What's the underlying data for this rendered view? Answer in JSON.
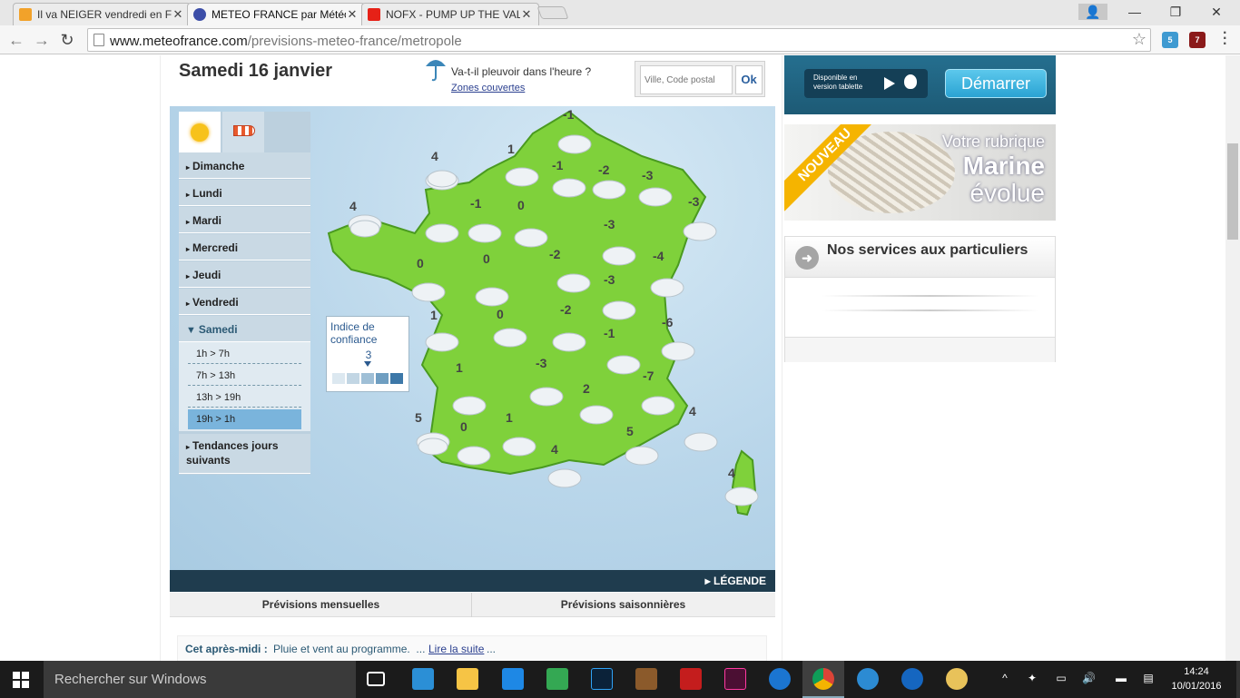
{
  "browser": {
    "tabs": [
      {
        "title": "Il va NEIGER vendredi en F",
        "favicon_color": "#f2a22a"
      },
      {
        "title": "METEO FRANCE par Météo",
        "favicon_color": "#3c4ea8"
      },
      {
        "title": "NOFX - PUMP UP THE VAL",
        "favicon_color": "#e62117"
      }
    ],
    "url_domain": "www.meteofrance.com",
    "url_path": "/previsions-meteo-france/metropole",
    "extensions": [
      {
        "icon": "ghostery-icon",
        "badge": "5",
        "color": "#3f9ad1"
      },
      {
        "icon": "ublock-icon",
        "badge": "7",
        "color": "#8b1a1a"
      }
    ]
  },
  "page": {
    "day_title": "Samedi 16 janvier",
    "rain_question": "Va-t-il pleuvoir dans l'heure ?",
    "zones_link": "Zones couvertes",
    "search_placeholder": "Ville, Code postal",
    "ok_label": "Ok",
    "days": [
      "Dimanche",
      "Lundi",
      "Mardi",
      "Mercredi",
      "Jeudi",
      "Vendredi",
      "Samedi"
    ],
    "open_day_index": 6,
    "time_slots": [
      "1h > 7h",
      "7h > 13h",
      "13h > 19h",
      "19h > 1h"
    ],
    "selected_slot_index": 3,
    "tendances": "Tendances jours suivants",
    "confidence_label": "Indice de confiance",
    "confidence_value": "3",
    "confidence_scale": [
      "#dce8f0",
      "#c2d6e4",
      "#9fbfd6",
      "#6f9ec1",
      "#3d78a8"
    ],
    "legend_link": "LÉGENDE",
    "prev_monthly": "Prévisions mensuelles",
    "prev_seasonal": "Prévisions saisonnières",
    "summary_label": "Cet après-midi :",
    "summary_text": "Pluie et vent au programme.",
    "summary_link": "Lire la suite",
    "summary_dots": "...",
    "summary_pre_dots": "...",
    "map_temperatures": [
      "-1",
      "1",
      "4",
      "-1",
      "-2",
      "-3",
      "-3",
      "4",
      "-1",
      "0",
      "-3",
      "0",
      "-2",
      "-4",
      "0",
      "-3",
      "-6",
      "1",
      "0",
      "-2",
      "-1",
      "1",
      "-3",
      "-7",
      "2",
      "4",
      "5",
      "0",
      "1",
      "5",
      "4",
      "4"
    ]
  },
  "sidebar_ads": {
    "app_store_text": "Disponible en version tablette",
    "app_button": "Démarrer",
    "marine_ribbon": "NOUVEAU",
    "marine_line1": "Votre rubrique",
    "marine_line2": "Marine",
    "marine_line3": "évolue",
    "services_title": "Nos services aux particuliers"
  },
  "taskbar": {
    "search_placeholder": "Rechercher sur Windows",
    "time": "14:24",
    "date": "10/01/2016"
  }
}
